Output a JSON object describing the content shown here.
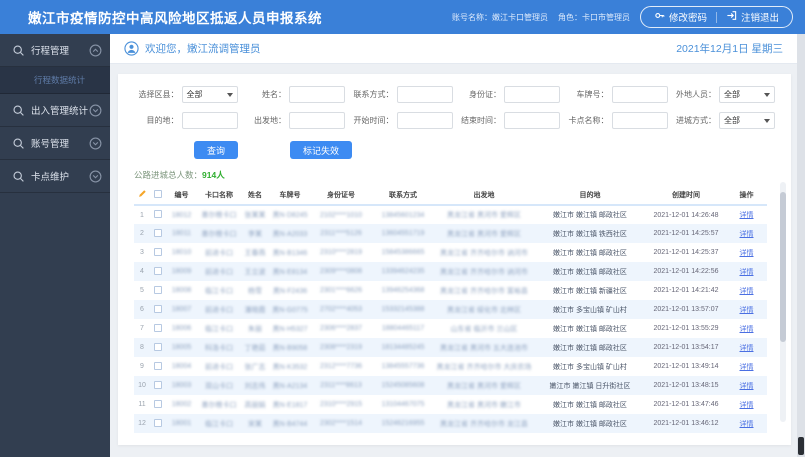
{
  "topbar": {
    "title": "嫩江市疫情防控中高风险地区抵返人员申报系统",
    "account_label": "账号名称：嫩江卡口管理员",
    "role_label": "角色：卡口市管理员",
    "change_password": "修改密码",
    "logout": "注销退出"
  },
  "sidebar": {
    "items": [
      {
        "label": "行程管理"
      },
      {
        "label": "行程数据统计"
      },
      {
        "label": "出入管理统计"
      },
      {
        "label": "账号管理"
      },
      {
        "label": "卡点维护"
      }
    ]
  },
  "welcome": {
    "text": "欢迎您，嫩江流调管理员",
    "date": "2021年12月1日 星期三"
  },
  "filters": {
    "fields": [
      {
        "label": "选择区县：",
        "type": "select",
        "value": "全部"
      },
      {
        "label": "姓名：",
        "type": "input",
        "value": ""
      },
      {
        "label": "联系方式：",
        "type": "input",
        "value": ""
      },
      {
        "label": "身份证：",
        "type": "input",
        "value": ""
      },
      {
        "label": "车牌号：",
        "type": "input",
        "value": ""
      },
      {
        "label": "外地人员：",
        "type": "select",
        "value": "全部"
      },
      {
        "label": "目的地：",
        "type": "input",
        "value": ""
      },
      {
        "label": "出发地：",
        "type": "input",
        "value": ""
      },
      {
        "label": "开始时间：",
        "type": "input",
        "value": ""
      },
      {
        "label": "结束时间：",
        "type": "input",
        "value": ""
      },
      {
        "label": "卡点名称：",
        "type": "input",
        "value": ""
      },
      {
        "label": "进城方式：",
        "type": "select",
        "value": "全部"
      }
    ]
  },
  "actions": {
    "query": "查询",
    "mark_invalid": "标记失效"
  },
  "stats": {
    "label": "公路进城总人数：",
    "value": "914人"
  },
  "table": {
    "columns": [
      "编号",
      "卡口名称",
      "姓名",
      "车牌号",
      "身份证号",
      "联系方式",
      "出发地",
      "目的地",
      "创建时间",
      "操作"
    ],
    "rows": [
      {
        "no": "1",
        "id": "18012",
        "checkpoint": "墨尔根卡口",
        "name": "张某某",
        "plate": "黑N·D8245",
        "idcard": "2102****1010",
        "phone": "13845601234",
        "origin": "黑龙江省 黑河市 爱辉区",
        "dest": "嫩江市 嫩江镇 邮政社区",
        "time": "2021-12-01 14:26:48",
        "action": "详情"
      },
      {
        "no": "2",
        "id": "18011",
        "checkpoint": "墨尔根卡口",
        "name": "李某",
        "plate": "黑N·A2033",
        "idcard": "2311****5126",
        "phone": "13604551719",
        "origin": "黑龙江省 黑河市 爱辉区",
        "dest": "嫩江市 嫩江镇 铁西社区",
        "time": "2021-12-01 14:25:57",
        "action": "详情"
      },
      {
        "no": "3",
        "id": "18010",
        "checkpoint": "前进卡口",
        "name": "王春燕",
        "plate": "黑N·B1346",
        "idcard": "2310****2819",
        "phone": "15845386665",
        "origin": "黑龙江省 齐齐哈尔市 讷河市",
        "dest": "嫩江市 嫩江镇 邮政社区",
        "time": "2021-12-01 14:25:37",
        "action": "详情"
      },
      {
        "no": "4",
        "id": "18009",
        "checkpoint": "前进卡口",
        "name": "王立波",
        "plate": "黑N·E8134",
        "idcard": "2309****0808",
        "phone": "13394624235",
        "origin": "黑龙江省 齐齐哈尔市 讷河市",
        "dest": "嫩江市 嫩江镇 邮政社区",
        "time": "2021-12-01 14:22:56",
        "action": "详情"
      },
      {
        "no": "5",
        "id": "18008",
        "checkpoint": "临江卡口",
        "name": "杨雪",
        "plate": "黑N·F2436",
        "idcard": "2301****6626",
        "phone": "13946254368",
        "origin": "黑龙江省 齐齐哈尔市 富裕县",
        "dest": "嫩江市 嫩江镇 新疆社区",
        "time": "2021-12-01 14:21:42",
        "action": "详情"
      },
      {
        "no": "6",
        "id": "18007",
        "checkpoint": "前进卡口",
        "name": "潘晓霞",
        "plate": "黑N·G0775",
        "idcard": "2702****4053",
        "phone": "15332145388",
        "origin": "黑龙江省 绥化市 北林区",
        "dest": "嫩江市 多宝山镇 矿山村",
        "time": "2021-12-01 13:57:07",
        "action": "详情"
      },
      {
        "no": "7",
        "id": "18006",
        "checkpoint": "临江卡口",
        "name": "朱丽",
        "plate": "黑N·H5327",
        "idcard": "2306****2837",
        "phone": "18804465117",
        "origin": "山东省 临沂市 兰山区",
        "dest": "嫩江市 嫩江镇 邮政社区",
        "time": "2021-12-01 13:55:29",
        "action": "详情"
      },
      {
        "no": "8",
        "id": "18005",
        "checkpoint": "科洛卡口",
        "name": "丁艳茹",
        "plate": "黑N·B9058",
        "idcard": "2308****2319",
        "phone": "18134485245",
        "origin": "黑龙江省 黑河市 五大连池市",
        "dest": "嫩江市 嫩江镇 邮政社区",
        "time": "2021-12-01 13:54:17",
        "action": "详情"
      },
      {
        "no": "9",
        "id": "18004",
        "checkpoint": "前进卡口",
        "name": "张广志",
        "plate": "黑N·K3532",
        "idcard": "2312****7736",
        "phone": "13845557736",
        "origin": "黑龙江省 齐齐哈尔市 大庆农场",
        "dest": "嫩江市 多宝山镇 矿山村",
        "time": "2021-12-01 13:49:14",
        "action": "详情"
      },
      {
        "no": "10",
        "id": "18003",
        "checkpoint": "双山卡口",
        "name": "刘志伟",
        "plate": "黑N·A2134",
        "idcard": "2311****8613",
        "phone": "15245085608",
        "origin": "黑龙江省 黑河市 爱辉区",
        "dest": "嫩江市 嫩江镇 日升街社区",
        "time": "2021-12-01 13:48:15",
        "action": "详情"
      },
      {
        "no": "11",
        "id": "18002",
        "checkpoint": "墨尔根卡口",
        "name": "高丽娟",
        "plate": "黑N·E1817",
        "idcard": "2310****2915",
        "phone": "13104467075",
        "origin": "黑龙江省 黑河市 嫩江市",
        "dest": "嫩江市 嫩江镇 邮政社区",
        "time": "2021-12-01 13:47:46",
        "action": "详情"
      },
      {
        "no": "12",
        "id": "18001",
        "checkpoint": "临江卡口",
        "name": "宋某",
        "plate": "黑N·B4744",
        "idcard": "2302****1514",
        "phone": "15246216955",
        "origin": "黑龙江省 齐齐哈尔市 龙江县",
        "dest": "嫩江市 嫩江镇 邮政社区",
        "time": "2021-12-01 13:46:12",
        "action": "详情"
      }
    ]
  }
}
